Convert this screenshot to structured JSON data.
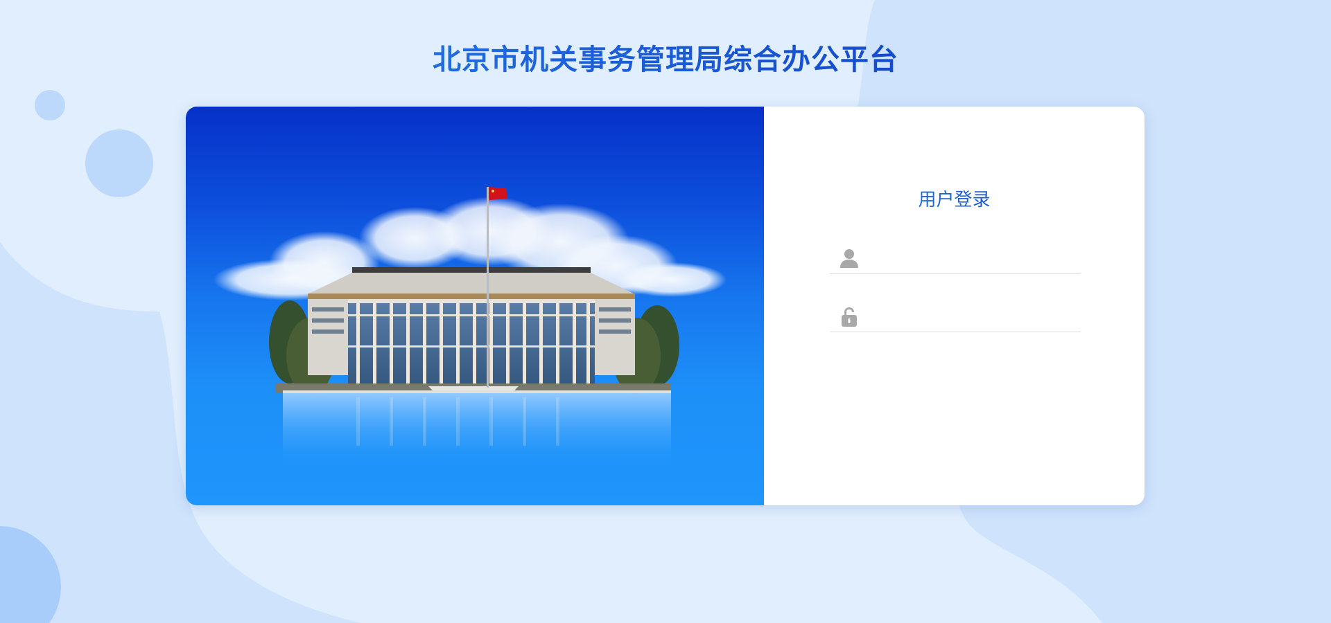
{
  "page": {
    "title": "北京市机关事务管理局综合办公平台",
    "background_color": "#e1eefd"
  },
  "illustration": {
    "subject": "government-building-with-flag"
  },
  "login": {
    "title": "用户登录",
    "username": {
      "icon": "user-icon",
      "value": "",
      "placeholder": ""
    },
    "password": {
      "icon": "lock-icon",
      "value": "",
      "placeholder": ""
    }
  },
  "colors": {
    "accent_blue": "#1c5fd9",
    "deep_blue": "#0631c8",
    "light_blue": "#1f96fb",
    "icon_gray": "#a8a8a8"
  }
}
